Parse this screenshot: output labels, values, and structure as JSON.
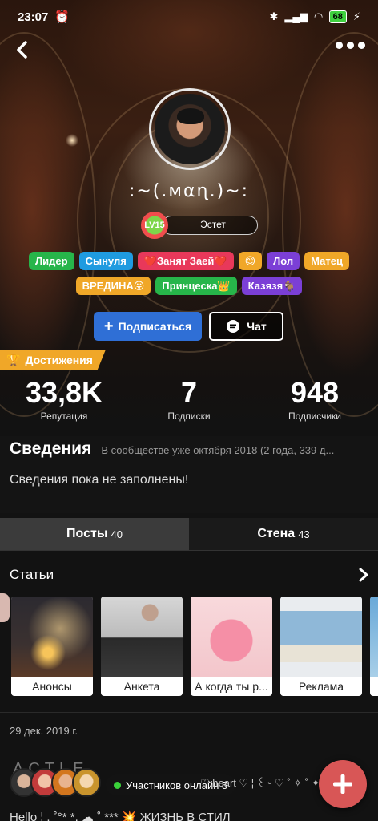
{
  "status_bar": {
    "time": "23:07",
    "battery": "68"
  },
  "profile": {
    "username": ":~(.мαɳ.)~:",
    "level": "LV15",
    "title": "Эстет"
  },
  "tags_row1": [
    {
      "label": "Лидер",
      "color": "#27b54a"
    },
    {
      "label": "Сынуля",
      "color": "#1f9be0"
    },
    {
      "label": "❤️Занят Заей❤️",
      "color": "#e8385a"
    },
    {
      "label": "😊",
      "color": "#f0a728"
    },
    {
      "label": "Лол",
      "color": "#7b3fd6"
    },
    {
      "label": "Матец",
      "color": "#f0a728"
    }
  ],
  "tags_row2": [
    {
      "label": "ВРЕДИНА😛",
      "color": "#f0a728"
    },
    {
      "label": "Принцеска👑",
      "color": "#27b54a"
    },
    {
      "label": "Казязя🐐",
      "color": "#7b3fd6"
    }
  ],
  "actions": {
    "follow": "Подписаться",
    "chat": "Чат"
  },
  "achievements": "Достижения",
  "stats": [
    {
      "value": "33,8K",
      "label": "Репутация"
    },
    {
      "value": "7",
      "label": "Подписки"
    },
    {
      "value": "948",
      "label": "Подписчики"
    }
  ],
  "info": {
    "heading": "Сведения",
    "member_since": "В сообществе уже октября 2018 (2 года, 339 д...",
    "body": "Сведения пока не заполнены!"
  },
  "tabs": [
    {
      "label": "Посты",
      "count": "40"
    },
    {
      "label": "Стена",
      "count": "43"
    }
  ],
  "articles": {
    "heading": "Статьи",
    "items": [
      {
        "caption": "Анонсы"
      },
      {
        "caption": "Анкета"
      },
      {
        "caption": "А когда ты р..."
      },
      {
        "caption": "Реклама"
      }
    ],
    "partial_caption": "Ц"
  },
  "post": {
    "date": "29 дек. 2019 г.",
    "title": "ACTLE"
  },
  "online": {
    "label": "Участников онлайн 5"
  },
  "chat_preview": "♡  heart  ♡  ¦ ꒰ ᵕ ♡ ˚ ✧ ˚ ✦",
  "last_line": "Hello ¦ . ˚°* *.  ☁  ˚  ***  💥 ЖИЗНЬ В СТИЛ"
}
